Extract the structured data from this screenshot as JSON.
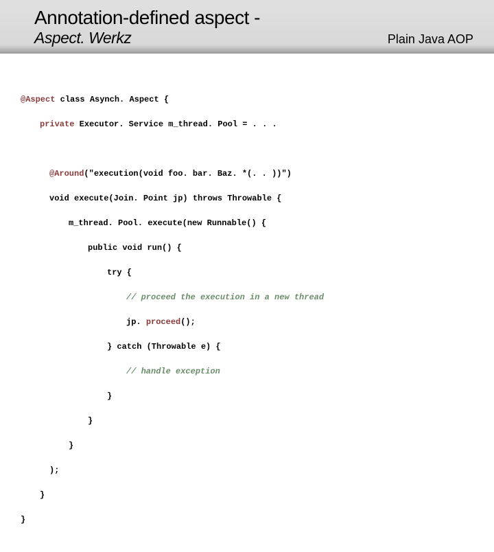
{
  "header": {
    "title": "Annotation-defined aspect -",
    "subtitle": "Aspect. Werkz",
    "tagline": "Plain Java AOP"
  },
  "code": {
    "l1_a": "@Aspect",
    "l1_b": " class Asynch. Aspect {",
    "l2_a": "private",
    "l2_b": " Executor. Service m_thread. Pool = . . .",
    "l3_a": "@Around",
    "l3_b": "(\"execution(void foo. bar. Baz. *(. . ))\")",
    "l4": "void execute(Join. Point jp) throws Throwable {",
    "l5": "m_thread. Pool. execute(new Runnable() {",
    "l6": "public void run() {",
    "l7": "try {",
    "l8": "// proceed the execution in a new thread",
    "l9_a": "jp. ",
    "l9_b": "proceed",
    "l9_c": "();",
    "l10": "} catch (Throwable e) {",
    "l11": "// handle exception",
    "l12": "}",
    "l13": "}",
    "l14": "}",
    "l15": ");",
    "l16": "}",
    "l17": "}"
  }
}
